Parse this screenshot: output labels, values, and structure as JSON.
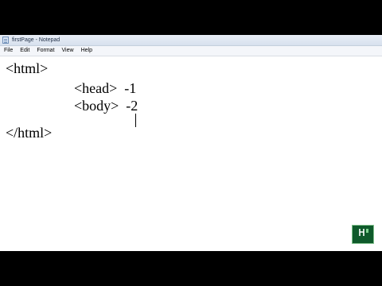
{
  "window": {
    "title": "firstPage - Notepad",
    "menu": [
      "File",
      "Edit",
      "Format",
      "View",
      "Help"
    ]
  },
  "editor": {
    "lines": [
      "<html>",
      "<head>  -1",
      "<body>  -2",
      "",
      "</html>"
    ]
  },
  "icons": {
    "app": "notepad-icon",
    "watermark": "channel-logo"
  },
  "colors": {
    "background": "#000000",
    "editor_bg": "#ffffff",
    "title_bar": "#dbe5f1",
    "logo": "#0f5a2b"
  }
}
